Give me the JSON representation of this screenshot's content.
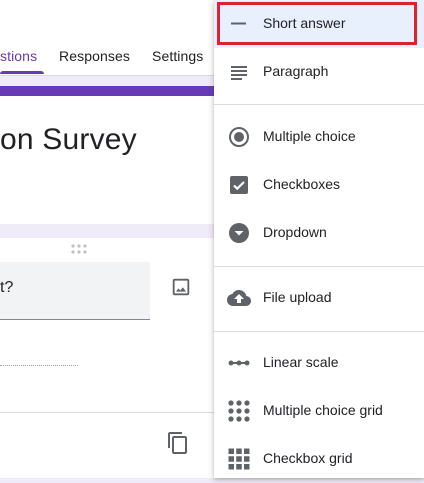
{
  "tabs": [
    {
      "label": "stions",
      "active": true
    },
    {
      "label": "Responses",
      "active": false
    },
    {
      "label": "Settings",
      "active": false
    }
  ],
  "form": {
    "title": "on Survey",
    "question_text": "t?"
  },
  "colors": {
    "accent": "#673ab7",
    "highlight_border": "#e0202f",
    "selected_bg": "#e8f0fe",
    "background": "#f0ebf8"
  },
  "icons": {
    "drag": "drag-handle-icon",
    "image": "image-icon",
    "copy": "copy-icon"
  },
  "menu": {
    "selected": "Short answer",
    "items": [
      {
        "label": "Short answer",
        "icon": "short-answer-icon"
      },
      {
        "label": "Paragraph",
        "icon": "paragraph-icon"
      },
      {
        "label": "Multiple choice",
        "icon": "radio-button-icon"
      },
      {
        "label": "Checkboxes",
        "icon": "checkbox-icon"
      },
      {
        "label": "Dropdown",
        "icon": "dropdown-circle-icon"
      },
      {
        "label": "File upload",
        "icon": "cloud-upload-icon"
      },
      {
        "label": "Linear scale",
        "icon": "linear-scale-icon"
      },
      {
        "label": "Multiple choice grid",
        "icon": "dot-grid-icon"
      },
      {
        "label": "Checkbox grid",
        "icon": "square-grid-icon"
      }
    ]
  }
}
